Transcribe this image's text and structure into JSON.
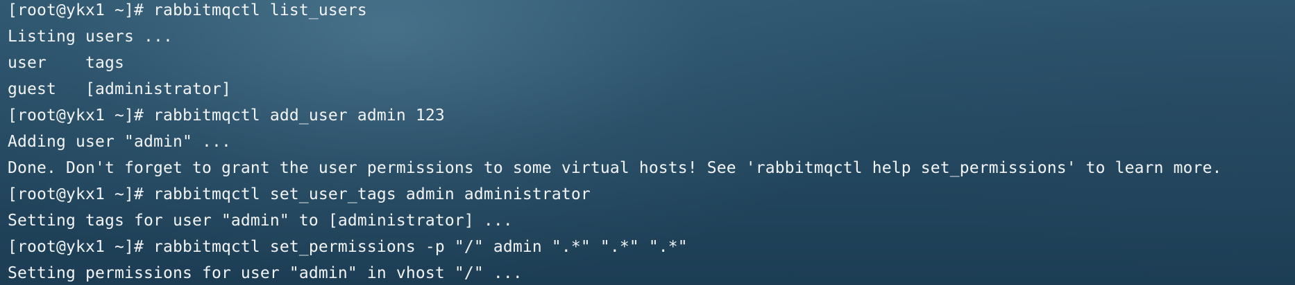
{
  "terminal": {
    "lines": [
      "[root@ykx1 ~]# rabbitmqctl list_users",
      "Listing users ...",
      "user    tags",
      "guest   [administrator]",
      "[root@ykx1 ~]# rabbitmqctl add_user admin 123",
      "Adding user \"admin\" ...",
      "Done. Don't forget to grant the user permissions to some virtual hosts! See 'rabbitmqctl help set_permissions' to learn more.",
      "[root@ykx1 ~]# rabbitmqctl set_user_tags admin administrator",
      "Setting tags for user \"admin\" to [administrator] ...",
      "[root@ykx1 ~]# rabbitmqctl set_permissions -p \"/\" admin \".*\" \".*\" \".*\"",
      "Setting permissions for user \"admin\" in vhost \"/\" ..."
    ]
  }
}
